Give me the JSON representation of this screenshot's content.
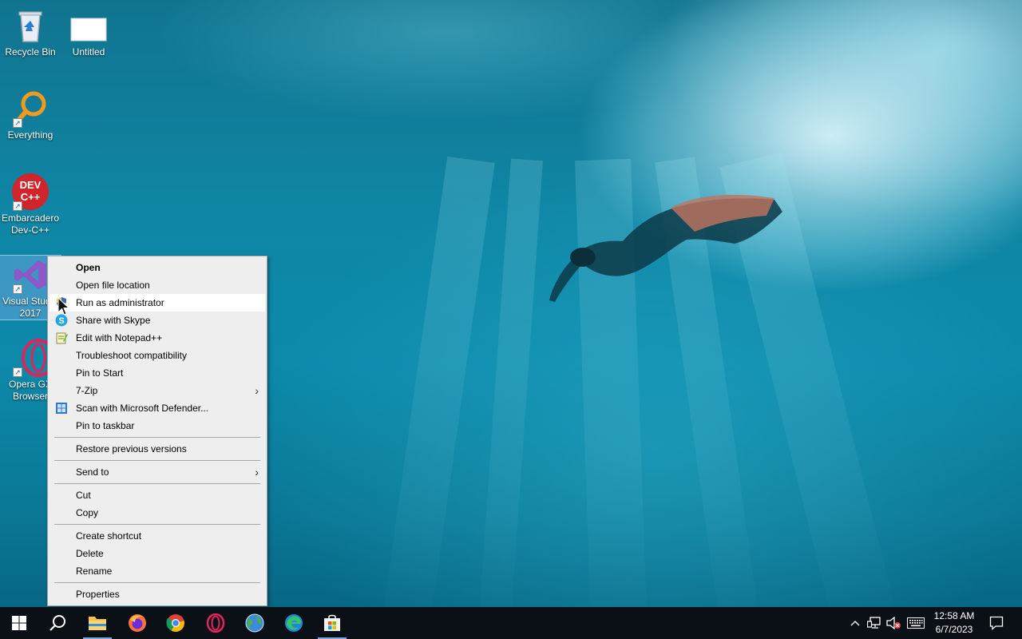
{
  "desktop": {
    "icons": [
      {
        "label": "Recycle Bin",
        "icon": "recycle-bin-icon"
      },
      {
        "label": "Untitled",
        "icon": "blank-file-icon"
      },
      {
        "label": "Everything",
        "icon": "everything-search-icon"
      },
      {
        "label": "Embarcadero Dev-C++",
        "icon": "devcpp-icon",
        "glyph_text": "DEV C++"
      },
      {
        "label": "Visual Studio 2017",
        "icon": "visual-studio-icon"
      },
      {
        "label": "Opera GX Browser",
        "icon": "opera-gx-icon"
      }
    ]
  },
  "context_menu": {
    "items": [
      {
        "label": "Open",
        "bold": true
      },
      {
        "label": "Open file location"
      },
      {
        "label": "Run as administrator",
        "icon": "shield-icon",
        "hovered": true
      },
      {
        "label": "Share with Skype",
        "icon": "skype-icon"
      },
      {
        "label": "Edit with Notepad++",
        "icon": "notepadpp-icon"
      },
      {
        "label": "Troubleshoot compatibility"
      },
      {
        "label": "Pin to Start"
      },
      {
        "label": "7-Zip",
        "submenu": true
      },
      {
        "label": "Scan with Microsoft Defender...",
        "icon": "defender-icon"
      },
      {
        "label": "Pin to taskbar"
      },
      {
        "label": "Restore previous versions"
      },
      {
        "label": "Send to",
        "submenu": true
      },
      {
        "label": "Cut"
      },
      {
        "label": "Copy"
      },
      {
        "label": "Create shortcut"
      },
      {
        "label": "Delete"
      },
      {
        "label": "Rename"
      },
      {
        "label": "Properties"
      }
    ]
  },
  "taskbar": {
    "apps": [
      {
        "name": "start",
        "icon": "windows-logo-icon"
      },
      {
        "name": "search",
        "icon": "search-icon"
      },
      {
        "name": "file-explorer",
        "icon": "folder-icon",
        "active": true
      },
      {
        "name": "firefox",
        "icon": "firefox-icon"
      },
      {
        "name": "chrome",
        "icon": "chrome-icon"
      },
      {
        "name": "opera",
        "icon": "opera-icon"
      },
      {
        "name": "globe-app",
        "icon": "globe-icon"
      },
      {
        "name": "edge",
        "icon": "edge-icon"
      },
      {
        "name": "store",
        "icon": "store-icon",
        "active": true
      }
    ],
    "tray": {
      "icons": [
        "chevron-up-icon",
        "network-icon",
        "volume-muted-icon",
        "keyboard-icon"
      ],
      "time": "12:58 AM",
      "date": "6/7/2023",
      "notification_icon": "notification-icon"
    }
  },
  "colors": {
    "taskbar_bg": "#0b0f16",
    "menu_bg": "#eeeeee",
    "menu_hover": "#ffffff",
    "selection": "#78aae6"
  }
}
